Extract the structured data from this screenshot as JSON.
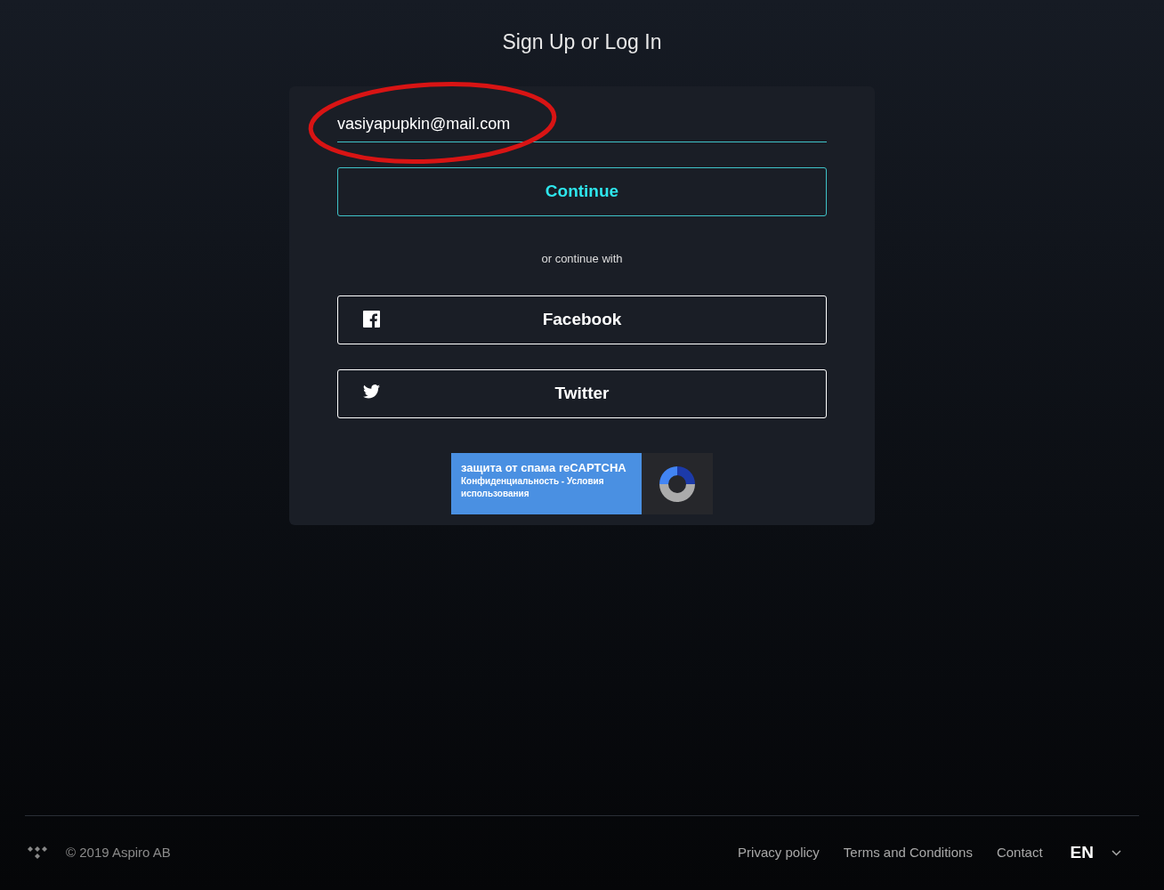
{
  "page": {
    "title": "Sign Up or Log In"
  },
  "email_field": {
    "value": "vasiyapupkin@mail.com"
  },
  "continue_button": {
    "label": "Continue"
  },
  "divider_text": "or continue with",
  "social_buttons": [
    {
      "kind": "facebook",
      "label": "Facebook"
    },
    {
      "kind": "twitter",
      "label": "Twitter"
    }
  ],
  "recaptcha": {
    "title": "защита от спама reCAPTCHA",
    "links": "Конфиденциальность - Условия использования"
  },
  "footer": {
    "copyright": "© 2019 Aspiro AB",
    "links": [
      "Privacy policy",
      "Terms and Conditions",
      "Contact"
    ],
    "language": "EN"
  }
}
